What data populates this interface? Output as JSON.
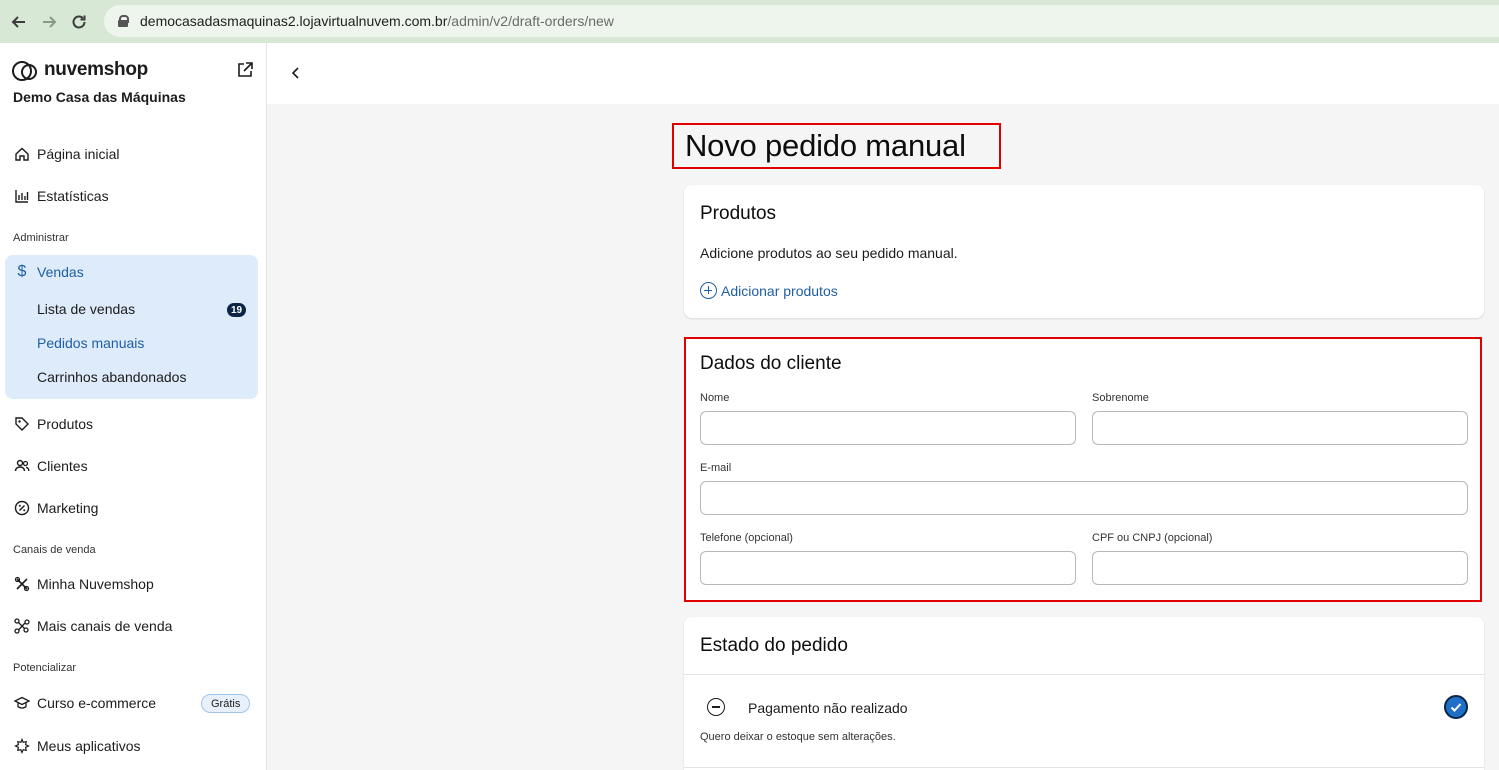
{
  "browser": {
    "url_host": "democasadasmaquinas2.lojavirtualnuvem.com.br",
    "url_path": "/admin/v2/draft-orders/new"
  },
  "sidebar": {
    "brand": "nuvemshop",
    "store_name": "Demo Casa das Máquinas",
    "home": "Página inicial",
    "stats": "Estatísticas",
    "section_admin": "Administrar",
    "vendas": {
      "label": "Vendas",
      "lista": "Lista de vendas",
      "lista_count": "19",
      "pedidos": "Pedidos manuais",
      "carrinhos": "Carrinhos abandonados"
    },
    "produtos": "Produtos",
    "clientes": "Clientes",
    "marketing": "Marketing",
    "section_canais": "Canais de venda",
    "minha_nuvemshop": "Minha Nuvemshop",
    "mais_canais": "Mais canais de venda",
    "section_potencializar": "Potencializar",
    "curso": "Curso e-commerce",
    "curso_badge": "Grátis",
    "aplicativos": "Meus aplicativos"
  },
  "main": {
    "title": "Novo pedido manual",
    "produtos": {
      "heading": "Produtos",
      "description": "Adicione produtos ao seu pedido manual.",
      "add_link": "Adicionar produtos"
    },
    "cliente": {
      "heading": "Dados do cliente",
      "nome_label": "Nome",
      "nome_value": "",
      "sobrenome_label": "Sobrenome",
      "sobrenome_value": "",
      "email_label": "E-mail",
      "email_value": "",
      "telefone_label": "Telefone (opcional)",
      "telefone_value": "",
      "cpf_label": "CPF ou CNPJ (opcional)",
      "cpf_value": ""
    },
    "estado": {
      "heading": "Estado do pedido",
      "status": "Pagamento não realizado",
      "note": "Quero deixar o estoque sem alterações."
    }
  },
  "colors": {
    "accent": "#1f5fa6",
    "highlight_border": "#e00000",
    "active_bg": "#ddebfa"
  }
}
